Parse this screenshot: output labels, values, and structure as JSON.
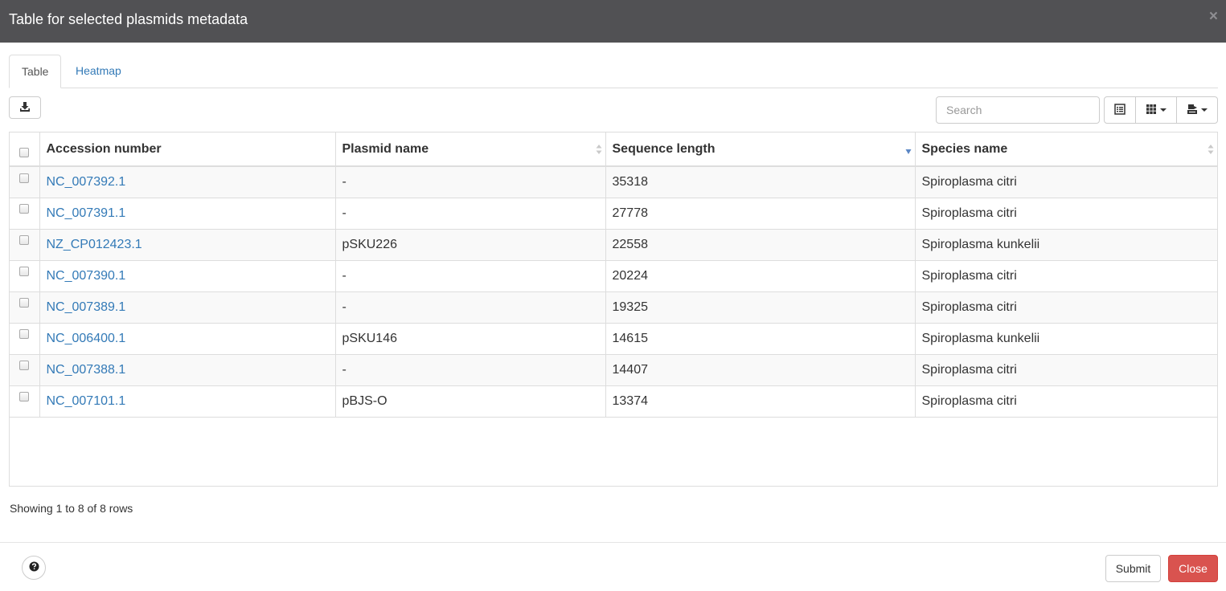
{
  "modal": {
    "title": "Table for selected plasmids metadata",
    "close_glyph": "×"
  },
  "tabs": [
    {
      "label": "Table",
      "active": true
    },
    {
      "label": "Heatmap",
      "active": false
    }
  ],
  "toolbar": {
    "export_icon": "download-icon",
    "search_placeholder": "Search",
    "buttons": [
      "toggle-view-icon",
      "columns-icon",
      "export-menu-icon"
    ]
  },
  "table": {
    "columns": [
      {
        "label": "Accession number",
        "sortable": false
      },
      {
        "label": "Plasmid name",
        "sortable": true,
        "sort": "none"
      },
      {
        "label": "Sequence length",
        "sortable": true,
        "sort": "desc"
      },
      {
        "label": "Species name",
        "sortable": true,
        "sort": "none"
      }
    ],
    "rows": [
      {
        "accession": "NC_007392.1",
        "plasmid": "-",
        "length": "35318",
        "species": "Spiroplasma citri"
      },
      {
        "accession": "NC_007391.1",
        "plasmid": "-",
        "length": "27778",
        "species": "Spiroplasma citri"
      },
      {
        "accession": "NZ_CP012423.1",
        "plasmid": "pSKU226",
        "length": "22558",
        "species": "Spiroplasma kunkelii"
      },
      {
        "accession": "NC_007390.1",
        "plasmid": "-",
        "length": "20224",
        "species": "Spiroplasma citri"
      },
      {
        "accession": "NC_007389.1",
        "plasmid": "-",
        "length": "19325",
        "species": "Spiroplasma citri"
      },
      {
        "accession": "NC_006400.1",
        "plasmid": "pSKU146",
        "length": "14615",
        "species": "Spiroplasma kunkelii"
      },
      {
        "accession": "NC_007388.1",
        "plasmid": "-",
        "length": "14407",
        "species": "Spiroplasma citri"
      },
      {
        "accession": "NC_007101.1",
        "plasmid": "pBJS-O",
        "length": "13374",
        "species": "Spiroplasma citri"
      }
    ]
  },
  "pagination": {
    "info": "Showing 1 to 8 of 8 rows"
  },
  "footer": {
    "help_icon": "question-circle-icon",
    "submit_label": "Submit",
    "close_label": "Close"
  },
  "colors": {
    "header_bg": "#515154",
    "link": "#337ab7",
    "danger": "#d9534f",
    "sort_active": "#5b87c5"
  }
}
